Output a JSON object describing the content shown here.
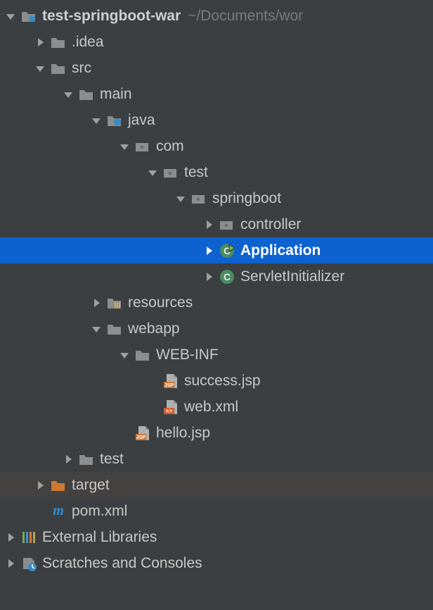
{
  "root": {
    "name": "test-springboot-war",
    "hint": "~/Documents/wor"
  },
  "nodes": {
    "idea": ".idea",
    "src": "src",
    "main": "main",
    "java": "java",
    "com": "com",
    "test": "test",
    "springboot": "springboot",
    "controller": "controller",
    "application": "Application",
    "servletinit": "ServletInitializer",
    "resources": "resources",
    "webapp": "webapp",
    "webinf": "WEB-INF",
    "successjsp": "success.jsp",
    "webxml": "web.xml",
    "hellojsp": "hello.jsp",
    "testdir": "test",
    "target": "target",
    "pom": "pom.xml",
    "extlib": "External Libraries",
    "scratches": "Scratches and Consoles"
  },
  "colors": {
    "folder": "#9a9c9e",
    "folder_source": "#3a8ac7",
    "folder_target": "#cd7832",
    "package": "#9a9c9e",
    "class_circle": "#4a8c60",
    "class_runnable": "#4a8c60",
    "jsp_badge": "#cd7832",
    "xml_badge": "#d25f33",
    "selection": "#0d62d0"
  }
}
